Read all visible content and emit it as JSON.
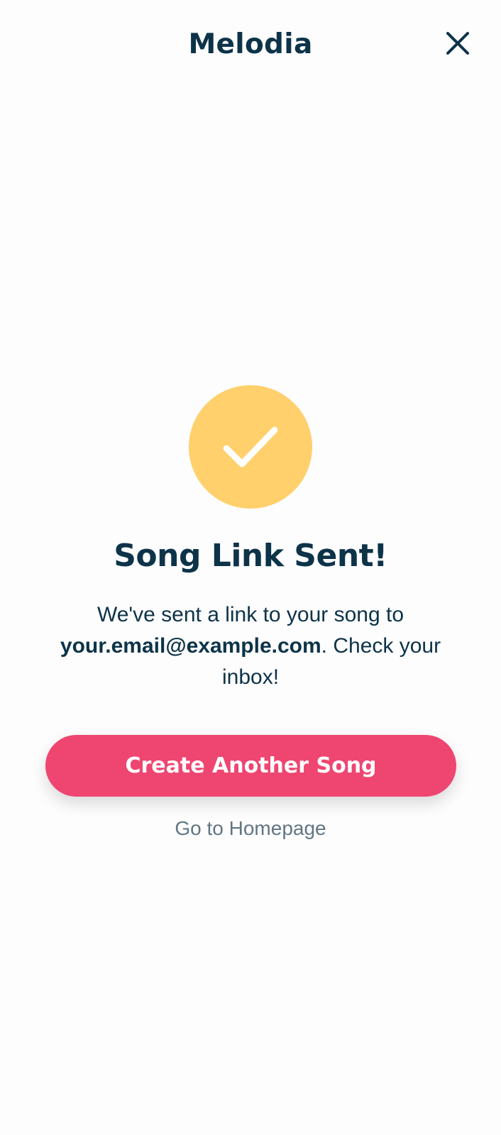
{
  "header": {
    "title": "Melodia",
    "close_icon": "close-icon"
  },
  "success": {
    "icon": "checkmark-icon",
    "badge_color": "#ffd06b",
    "title": "Song Link Sent!",
    "message_before": "We've sent a link to your song to ",
    "email": "your.email@example.com",
    "message_after": ". Check your inbox!"
  },
  "actions": {
    "primary_label": "Create Another Song",
    "primary_color": "#ee4671",
    "secondary_label": "Go to Homepage"
  },
  "colors": {
    "text_primary": "#0d3349",
    "text_secondary": "#627684",
    "background": "#fdfdfd"
  }
}
